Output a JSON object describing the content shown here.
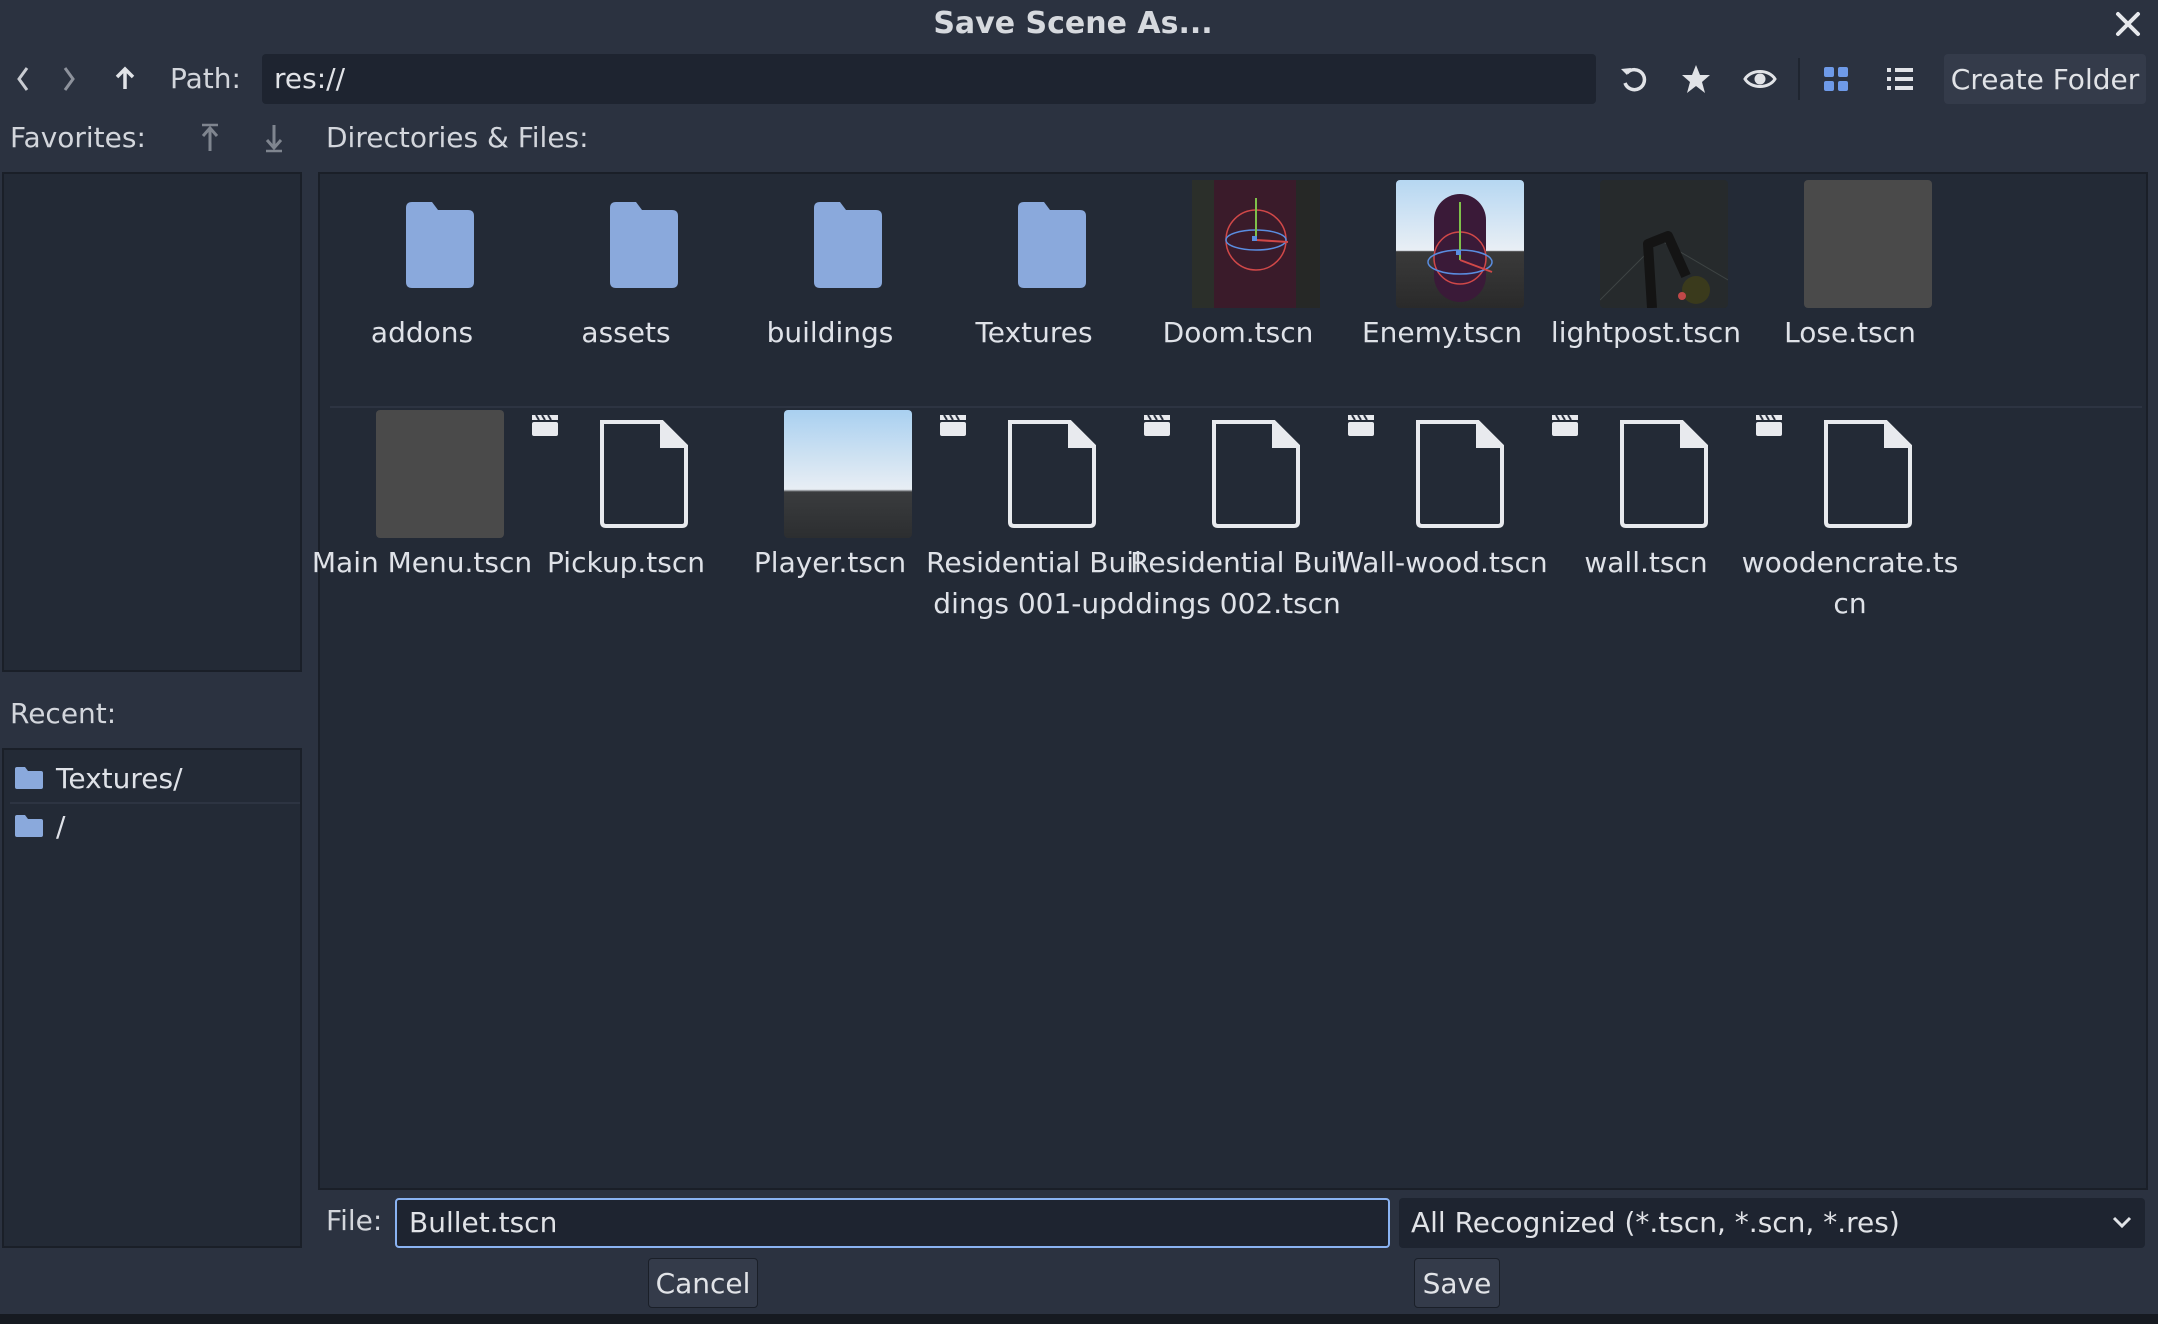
{
  "window": {
    "title": "Save Scene As..."
  },
  "toolbar": {
    "path_label": "Path:",
    "path_value": "res://",
    "create_folder_label": "Create Folder"
  },
  "favorites": {
    "label": "Favorites:"
  },
  "directories": {
    "label": "Directories & Files:"
  },
  "recent": {
    "label": "Recent:",
    "items": [
      {
        "label": "Textures/"
      },
      {
        "label": "/"
      }
    ]
  },
  "files": [
    {
      "name": "addons",
      "kind": "folder"
    },
    {
      "name": "assets",
      "kind": "folder"
    },
    {
      "name": "buildings",
      "kind": "folder"
    },
    {
      "name": "Textures",
      "kind": "folder"
    },
    {
      "name": "Doom.tscn",
      "kind": "scene-preview"
    },
    {
      "name": "Enemy.tscn",
      "kind": "scene-preview"
    },
    {
      "name": "lightpost.tscn",
      "kind": "scene-preview"
    },
    {
      "name": "Lose.tscn",
      "kind": "scene-preview"
    },
    {
      "name": "Main Menu.tscn",
      "kind": "scene-preview"
    },
    {
      "name": "Pickup.tscn",
      "kind": "scene-file"
    },
    {
      "name": "Player.tscn",
      "kind": "scene-preview"
    },
    {
      "name": "Residential Buildings 001-upd",
      "kind": "scene-file"
    },
    {
      "name": "Residential Buildings 002.tscn",
      "kind": "scene-file"
    },
    {
      "name": "Wall-wood.tscn",
      "kind": "scene-file"
    },
    {
      "name": "wall.tscn",
      "kind": "scene-file"
    },
    {
      "name": "woodencrate.tscn",
      "kind": "scene-file"
    }
  ],
  "footer": {
    "file_label": "File:",
    "file_value": "Bullet.tscn",
    "filter_value": "All Recognized (*.tscn, *.scn, *.res)",
    "cancel_label": "Cancel",
    "save_label": "Save"
  },
  "colors": {
    "background": "#2b3240",
    "panel": "#232a36",
    "folder": "#8aa9dc",
    "accent": "#8ab3f2",
    "view_icon_active": "#6e9ae8"
  }
}
